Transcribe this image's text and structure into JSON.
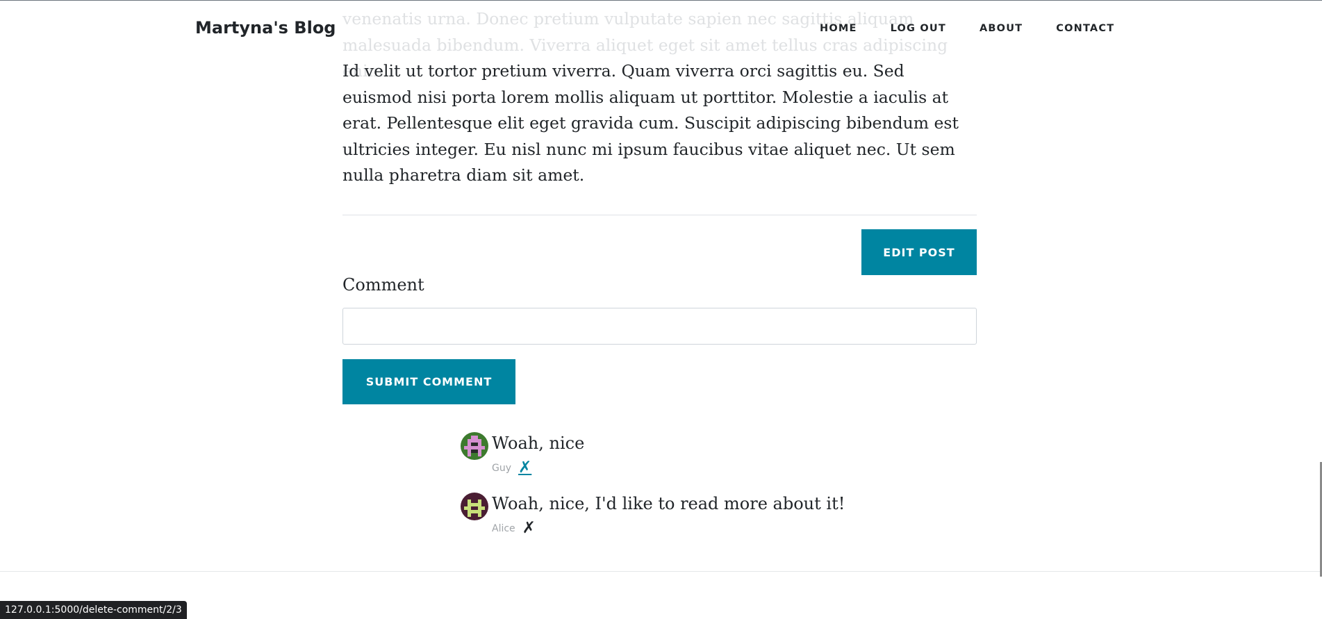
{
  "navbar": {
    "brand": "Martyna's Blog",
    "links": [
      "HOME",
      "LOG OUT",
      "ABOUT",
      "CONTACT"
    ]
  },
  "post": {
    "faded_text": "venenatis urna. Donec pretium vulputate sapien nec sagittis aliquam malesuada bibendum. Viverra aliquet eget sit amet tellus cras adipiscing enim.",
    "body_text": "Id velit ut tortor pretium viverra. Quam viverra orci sagittis eu. Sed euismod nisi porta lorem mollis aliquam ut porttitor. Molestie a iaculis at erat. Pellentesque elit eget gravida cum. Suscipit adipiscing bibendum est ultricies integer. Eu nisl nunc mi ipsum faucibus vitae aliquet nec. Ut sem nulla pharetra diam sit amet.",
    "edit_button": "EDIT POST"
  },
  "comment_form": {
    "label": "Comment",
    "value": "",
    "submit_button": "SUBMIT COMMENT"
  },
  "comments": [
    {
      "text": "Woah, nice",
      "author": "Guy",
      "delete_label": "✗",
      "avatar_colors": {
        "bg": "#3d7a2e",
        "fg": "#d58fd0",
        "dark": "#2a2a2a"
      }
    },
    {
      "text": "Woah, nice, I'd like to read more about it!",
      "author": "Alice",
      "delete_label": "✗",
      "avatar_colors": {
        "bg": "#4a1e33",
        "fg": "#c8e07a",
        "dark": "#4a1e33"
      }
    }
  ],
  "status_bar": {
    "url": "127.0.0.1:5000/delete-comment/2/3"
  },
  "colors": {
    "accent": "#0085a1",
    "text": "#212529",
    "muted": "#a0a4a8"
  }
}
